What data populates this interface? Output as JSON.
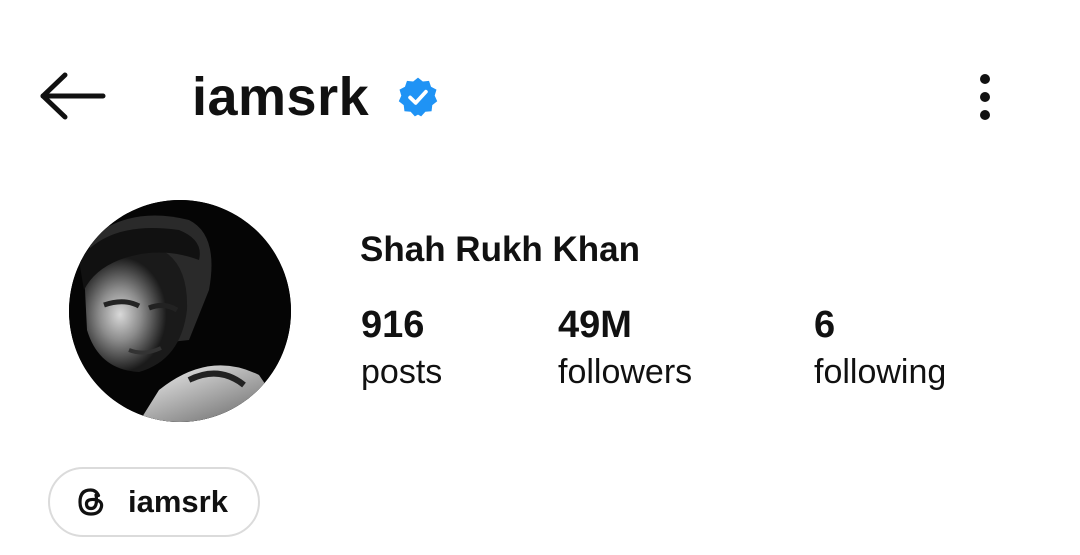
{
  "header": {
    "username": "iamsrk",
    "verified": true,
    "back_icon": "arrow-left-icon",
    "more_icon": "more-vertical-icon",
    "badge_color": "#1f93f5"
  },
  "profile": {
    "display_name": "Shah Rukh Khan",
    "avatar_description": "avatar"
  },
  "stats": [
    {
      "value": "916",
      "label": "posts"
    },
    {
      "value": "49M",
      "label": "followers"
    },
    {
      "value": "6",
      "label": "following"
    }
  ],
  "threads_link": {
    "icon": "threads-icon",
    "label": "iamsrk"
  }
}
